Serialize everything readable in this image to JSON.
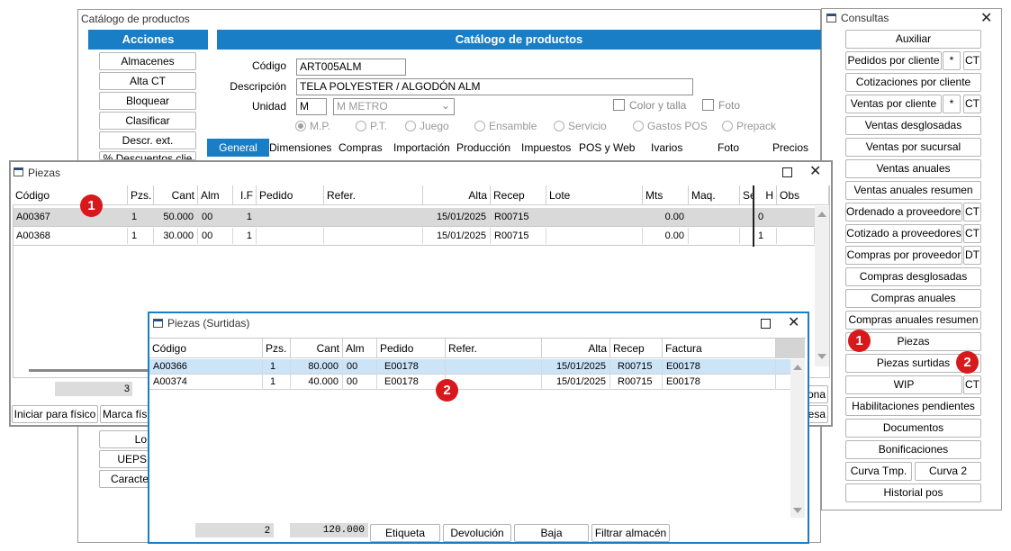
{
  "catalog": {
    "window_title": "Catálogo de productos",
    "acciones_header": "Acciones",
    "panel_header": "Catálogo de productos",
    "actions": [
      "Almacenes",
      "Alta CT",
      "Bloquear",
      "Clasificar",
      "Descr. ext.",
      "% Descuentos clie"
    ],
    "actions_lower": [
      "Lo",
      "UEPS",
      "Caracte"
    ],
    "codigo_label": "Código",
    "codigo_value": "ART005ALM",
    "descripcion_label": "Descripción",
    "descripcion_value": "TELA POLYESTER / ALGODÓN ALM",
    "unidad_label": "Unidad",
    "unidad_value": "M",
    "unidad_select": "M   METRO",
    "color_talla": "Color y talla",
    "foto_check": "Foto",
    "radios": [
      "M.P.",
      "P.T.",
      "Juego",
      "Ensamble",
      "Servicio",
      "Gastos POS",
      "Prepack"
    ],
    "tabs": [
      "General",
      "Dimensiones",
      "Compras",
      "Importación",
      "Producción",
      "Impuestos",
      "POS y Web",
      "Ivarios",
      "Foto",
      "Precios"
    ],
    "right_partial_1": "ona",
    "right_partial_2": "esa"
  },
  "piezas": {
    "title": "Piezas",
    "columns": [
      "Código",
      "Pzs.",
      "Cant",
      "Alm",
      "I.F",
      "Pedido",
      "Refer.",
      "Alta",
      "Recep",
      "Lote",
      "Mts",
      "Maq.",
      "Se",
      "H",
      "Obs"
    ],
    "rows": [
      {
        "codigo": "A00367",
        "pzs": "1",
        "cant": "50.000",
        "alm": "00",
        "if": "1",
        "pedido": "",
        "refer": "",
        "alta": "15/01/2025",
        "recep": "R00715",
        "lote": "",
        "mts": "0.00",
        "maq": "",
        "se": "",
        "h": "0",
        "obs": ""
      },
      {
        "codigo": "A00368",
        "pzs": "1",
        "cant": "30.000",
        "alm": "00",
        "if": "1",
        "pedido": "",
        "refer": "",
        "alta": "15/01/2025",
        "recep": "R00715",
        "lote": "",
        "mts": "0.00",
        "maq": "",
        "se": "",
        "h": "1",
        "obs": ""
      }
    ],
    "footer_count": "3",
    "btn_iniciar": "Iniciar para físico",
    "btn_marca": "Marca físi"
  },
  "surtidas": {
    "title": "Piezas (Surtidas)",
    "columns": [
      "Código",
      "Pzs.",
      "Cant",
      "Alm",
      "Pedido",
      "Refer.",
      "Alta",
      "Recep",
      "Factura"
    ],
    "rows": [
      {
        "codigo": "A00366",
        "pzs": "1",
        "cant": "80.000",
        "alm": "00",
        "pedido": "E00178",
        "refer": "",
        "alta": "15/01/2025",
        "recep": "R00715",
        "factura": "E00178"
      },
      {
        "codigo": "A00374",
        "pzs": "1",
        "cant": "40.000",
        "alm": "00",
        "pedido": "E00178",
        "refer": "",
        "alta": "15/01/2025",
        "recep": "R00715",
        "factura": "E00178"
      }
    ],
    "total_count": "2",
    "total_cant": "120.000",
    "buttons": [
      "Etiqueta",
      "Devolución",
      "Baja",
      "Filtrar almacén"
    ]
  },
  "consultas": {
    "title": "Consultas",
    "items": [
      {
        "label": "Auxiliar"
      },
      {
        "label": "Pedidos por cliente",
        "extra": [
          "*",
          "CT"
        ]
      },
      {
        "label": "Cotizaciones por cliente"
      },
      {
        "label": "Ventas por cliente",
        "extra": [
          "*",
          "CT"
        ]
      },
      {
        "label": "Ventas desglosadas"
      },
      {
        "label": "Ventas por sucursal"
      },
      {
        "label": "Ventas anuales"
      },
      {
        "label": "Ventas anuales resumen"
      },
      {
        "label": "Ordenado a proveedores",
        "extra": [
          "CT"
        ]
      },
      {
        "label": "Cotizado a proveedores",
        "extra": [
          "CT"
        ]
      },
      {
        "label": "Compras por proveedor",
        "extra": [
          "DT"
        ]
      },
      {
        "label": "Compras desglosadas"
      },
      {
        "label": "Compras anuales"
      },
      {
        "label": "Compras anuales resumen"
      },
      {
        "label": "Piezas"
      },
      {
        "label": "Piezas surtidas"
      },
      {
        "label": "WIP",
        "extra": [
          "CT"
        ]
      },
      {
        "label": "Habilitaciones pendientes"
      },
      {
        "label": "Documentos"
      },
      {
        "label": "Bonificaciones"
      },
      {
        "label": "Curva Tmp.",
        "extra": [
          "Curva 2"
        ]
      },
      {
        "label": "Historial pos"
      }
    ]
  },
  "badges": [
    "1",
    "2"
  ],
  "colors": {
    "accent": "#1a7ec6",
    "badge": "#d7191c",
    "selected_row": "#cce4f7",
    "active_border": "#1a7ec6"
  }
}
